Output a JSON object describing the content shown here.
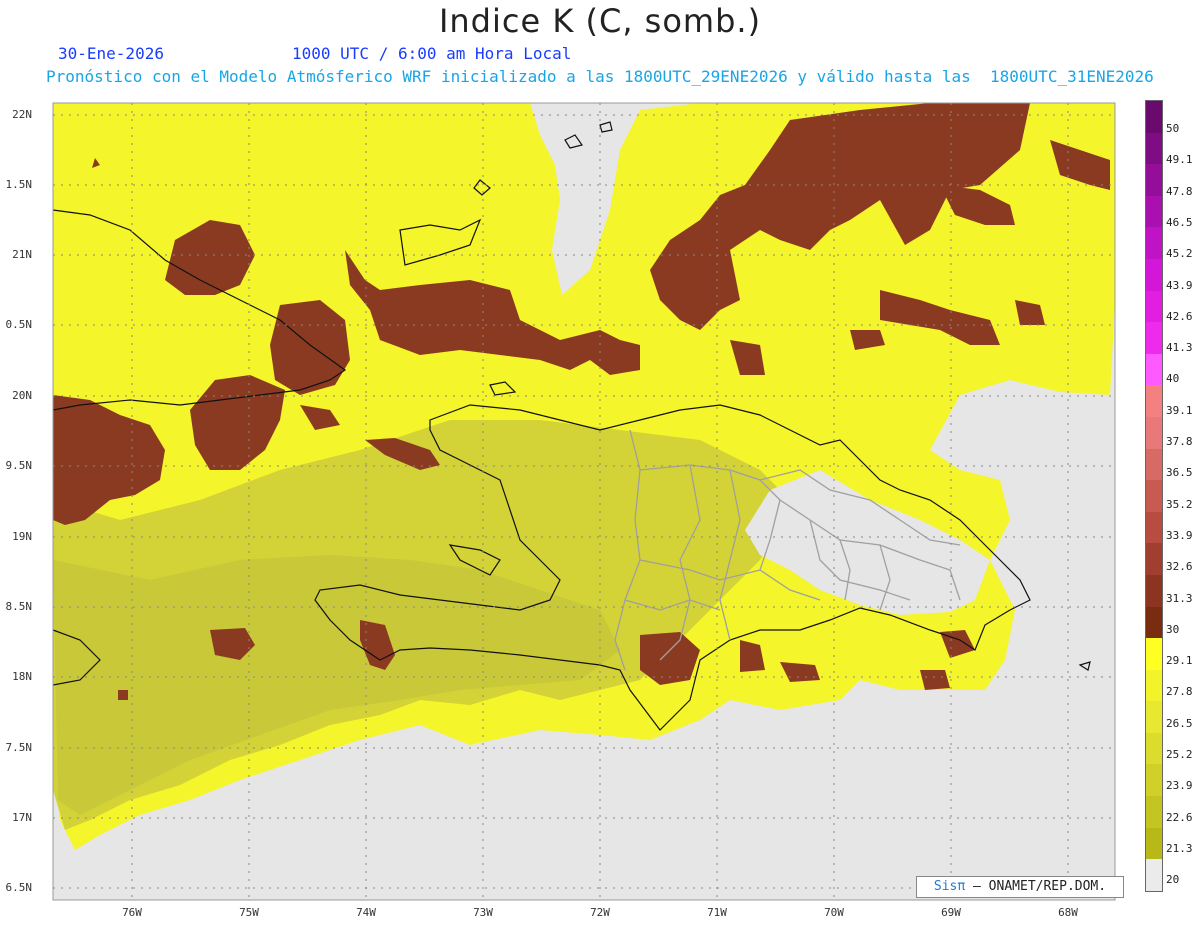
{
  "title": "Indice K (C, somb.)",
  "date_line": "30-Ene-2026",
  "time_line": "1000 UTC / 6:00 am Hora Local",
  "model_line": "Pronóstico con el Modelo Atmósferico WRF inicializado a las 1800UTC_29ENE2026 y válido hasta las  1800UTC_31ENE2026",
  "lat_labels": [
    "22N",
    "1.5N",
    "21N",
    "0.5N",
    "20N",
    "9.5N",
    "19N",
    "8.5N",
    "18N",
    "7.5N",
    "17N",
    "6.5N"
  ],
  "lon_labels": [
    "76W",
    "75W",
    "74W",
    "73W",
    "72W",
    "71W",
    "70W",
    "69W",
    "68W"
  ],
  "colorbar": {
    "labels": [
      "50",
      "49.1",
      "47.8",
      "46.5",
      "45.2",
      "43.9",
      "42.6",
      "41.3",
      "40",
      "39.1",
      "37.8",
      "36.5",
      "35.2",
      "33.9",
      "32.6",
      "31.3",
      "30",
      "29.1",
      "27.8",
      "26.5",
      "25.2",
      "23.9",
      "22.6",
      "21.3",
      "20"
    ],
    "colors": [
      "#6a0a6e",
      "#7e0c82",
      "#940e99",
      "#aa10b0",
      "#c013c6",
      "#d317d8",
      "#e21ee3",
      "#ee2aed",
      "#ff5aff",
      "#f58080",
      "#e8787a",
      "#d86a66",
      "#c85a52",
      "#b84c40",
      "#a23e30",
      "#8c3420",
      "#7a2c10",
      "#ffff22",
      "#f3f32a",
      "#e8e830",
      "#dcdc2c",
      "#d0d028",
      "#c4c422",
      "#b8b818",
      "#ebebeb"
    ]
  },
  "credit": {
    "logo": "Sisπ",
    "text": "– ONAMET/REP.DOM."
  },
  "legend_colors": {
    "ocean_no_data": "#e6e6e6",
    "yellow": "#ffff33",
    "olive": "#c9c93c",
    "brown": "#8b3a22"
  }
}
